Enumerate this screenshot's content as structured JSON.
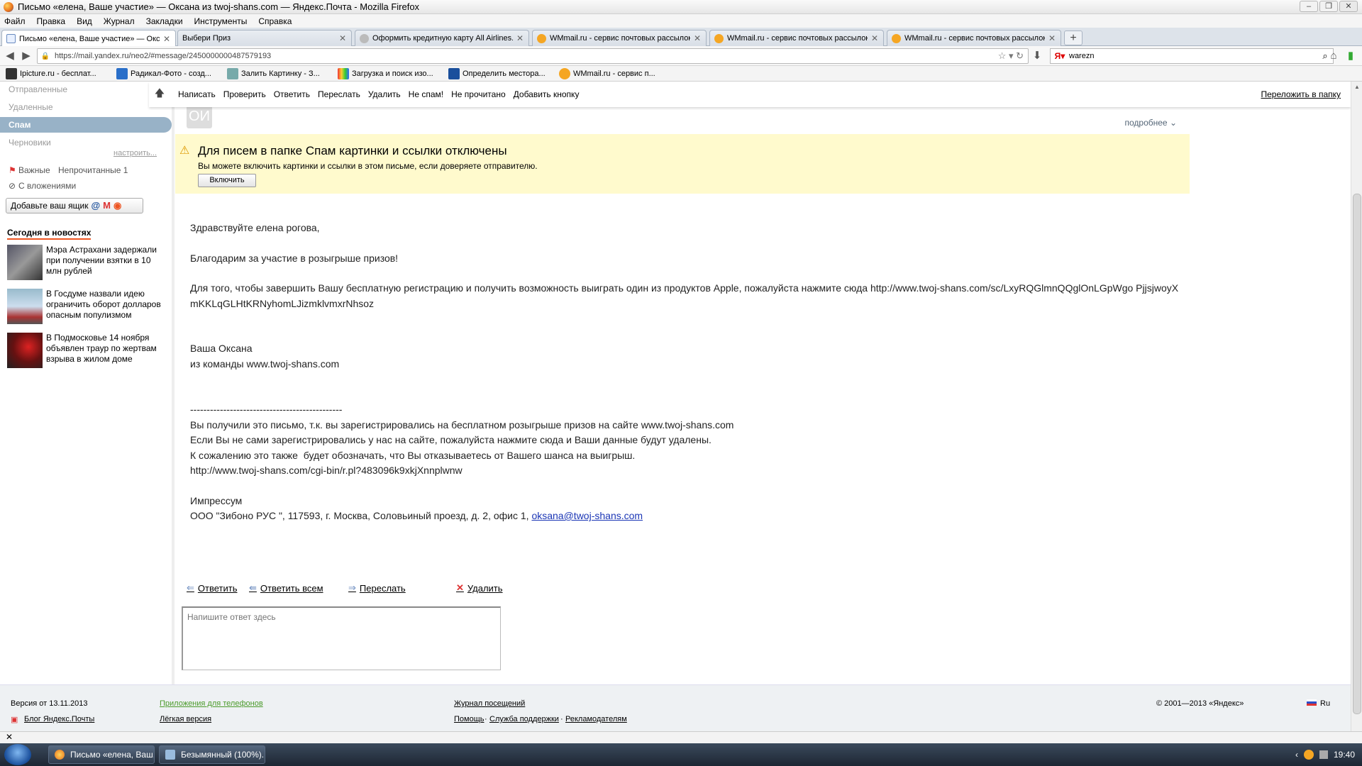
{
  "window": {
    "title": "Письмо «елена, Ваше участие» — Оксана из twoj-shans.com — Яндекс.Почта - Mozilla Firefox"
  },
  "menu": [
    "Файл",
    "Правка",
    "Вид",
    "Журнал",
    "Закладки",
    "Инструменты",
    "Справка"
  ],
  "tabs": [
    {
      "label": "Письмо «елена, Ваше участие» — Окс..."
    },
    {
      "label": "Выбери Приз"
    },
    {
      "label": "Оформить кредитную карту All Airlines..."
    },
    {
      "label": "WMmail.ru - сервис почтовых рассылок..."
    },
    {
      "label": "WMmail.ru - сервис почтовых рассылок..."
    },
    {
      "label": "WMmail.ru - сервис почтовых рассылок..."
    }
  ],
  "address": {
    "url": "https://mail.yandex.ru/neo2/#message/2450000000487579193"
  },
  "search": {
    "value": "warezn"
  },
  "bookmarks": [
    {
      "label": "Ipicture.ru - бесплат..."
    },
    {
      "label": "Радикал-Фото - созд..."
    },
    {
      "label": "Залить Картинку - З..."
    },
    {
      "label": "Загрузка и поиск изо..."
    },
    {
      "label": "Определить местора..."
    },
    {
      "label": "WMmail.ru - сервис п..."
    }
  ],
  "sidebar": {
    "folders": [
      {
        "label": "Отправленные"
      },
      {
        "label": "Удаленные"
      },
      {
        "label": "Спам"
      },
      {
        "label": "Черновики"
      }
    ],
    "setup_link": "настроить...",
    "filter_important": "Важные",
    "filter_unread": "Непрочитанные 1",
    "filter_attachments": "С вложениями",
    "add_box": "Добавьте ваш ящик",
    "news_title": "Сегодня в новостях",
    "news": [
      {
        "text": "Мэра Астрахани задержали при получении взятки в 10 млн рублей"
      },
      {
        "text": "В Госдуме назвали идею ограничить оборот долларов опасным популизмом"
      },
      {
        "text": "В Подмосковье 14 ноября объявлен траур по жертвам взрыва в жилом доме"
      }
    ]
  },
  "toolbar": {
    "buttons": [
      "Написать",
      "Проверить",
      "Ответить",
      "Переслать",
      "Удалить",
      "Не спам!",
      "Не прочитано",
      "Добавить кнопку"
    ],
    "move": "Переложить в папку"
  },
  "message": {
    "avatar": "ОИ",
    "details_link": "подробнее",
    "spam_notice": {
      "heading": "Для писем в папке Спам картинки и ссылки отключены",
      "text": "Вы можете включить картинки и ссылки в этом письме, если доверяете отправителю.",
      "button": "Включить"
    },
    "greeting": "Здравствуйте елена рогова,",
    "thanks": "Благодарим за участие в розыгрыше призов!",
    "paragraph": "Для того, чтобы завершить Вашу бесплатную регистрацию и получить возможность выиграть один из продуктов Apple, пожалуйста нажмите сюда http://www.twoj-shans.com/sc/LxyRQGlmnQQglOnLGpWgo PjjsjwoyXmKKLqGLHtKRNyhomLJizmklvmxrNhsoz",
    "sign1": "Ваша Оксана",
    "sign2": "из команды www.twoj-shans.com",
    "divider": "----------------------------------------------",
    "footer1": "Вы получили это письмо, т.к. вы зарегистрировались на бесплатном розыгрыше призов на сайте www.twoj-shans.com",
    "footer2": "Если Вы не сами зарегистрировались у нас на сайте, пожалуйста нажмите сюда и Ваши данные будут удалены.",
    "footer3": "К сожалению это также  будет обозначать, что Вы отказываетесь от Вашего шанса на выигрыш.",
    "footer4": "http://www.twoj-shans.com/cgi-bin/r.pl?483096k9xkjXnnplwnw",
    "impressum": "Импрессум",
    "company": "ООО \"Зибоно РУС \", 117593, г. Москва, Соловьиный проезд, д. 2, офис 1, ",
    "email": "oksana@twoj-shans.com"
  },
  "actions": {
    "reply": "Ответить",
    "reply_all": "Ответить всем",
    "forward": "Переслать",
    "delete": "Удалить",
    "reply_placeholder": "Напишите ответ здесь"
  },
  "footer": {
    "version": "Версия от 13.11.2013",
    "blog": "Блог Яндекс.Почты",
    "apps": "Приложения для телефонов",
    "lite": "Лёгкая версия",
    "journal": "Журнал посещений",
    "help": "Помощь",
    "support": "Служба поддержки",
    "ads": "Рекламодателям",
    "copyright": "© 2001—2013 «Яндекс»",
    "lang": "Ru"
  },
  "taskbar": {
    "tasks": [
      {
        "label": "Письмо «елена, Ваш..."
      },
      {
        "label": "Безымянный (100%)..."
      }
    ],
    "clock": "19:40"
  },
  "colors": {
    "spam_banner": "#fffacd",
    "active_folder": "#98b2c7",
    "link": "#1a35b5"
  }
}
